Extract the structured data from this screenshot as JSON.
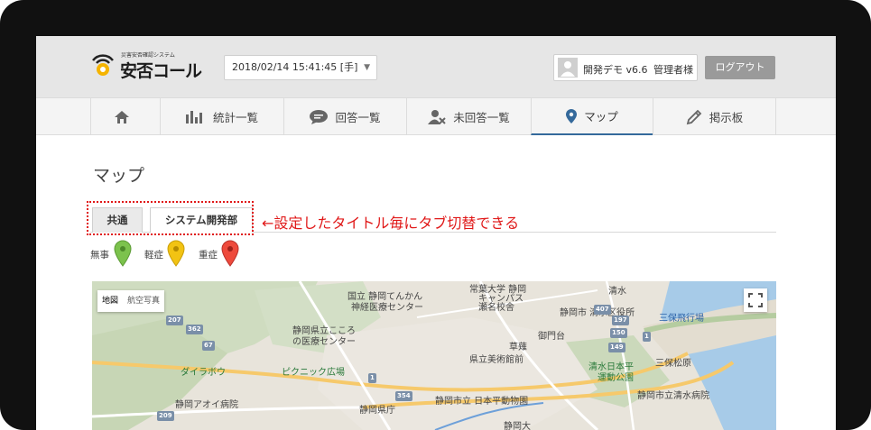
{
  "app": {
    "logo_small": "災害安否確認システム",
    "logo_text": "安否コール"
  },
  "header": {
    "datetime_select": "2018/02/14 15:41:45 [手]",
    "user_name": "開発デモ v6.6",
    "user_role": "管理者様",
    "logout_label": "ログアウト"
  },
  "nav": {
    "items": [
      {
        "label": "",
        "icon": "home-icon"
      },
      {
        "label": "統計一覧",
        "icon": "bar-chart-icon"
      },
      {
        "label": "回答一覧",
        "icon": "chat-icon"
      },
      {
        "label": "未回答一覧",
        "icon": "user-x-icon"
      },
      {
        "label": "マップ",
        "icon": "map-pin-icon",
        "active": true
      },
      {
        "label": "掲示板",
        "icon": "pencil-icon"
      }
    ]
  },
  "page": {
    "title": "マップ",
    "tabs": [
      "共通",
      "システム開発部"
    ],
    "annotation": "←設定したタイトル毎にタブ切替できる"
  },
  "legend": [
    {
      "label": "無事",
      "color": "#7cc24d"
    },
    {
      "label": "軽症",
      "color": "#f2c313"
    },
    {
      "label": "重症",
      "color": "#ee4a3c"
    }
  ],
  "map": {
    "toggle": [
      "地図",
      "航空写真"
    ],
    "labels": {
      "l1": "国立 静岡てんかん",
      "l2": "神経医療センター",
      "l3": "常葉大学 静岡",
      "l4": "キャンパス",
      "l5": "瀬名校舎",
      "l6": "清水",
      "l7": "静岡市 清水区役所",
      "l8": "三保飛行場",
      "l9": "静岡県立こころ",
      "l10": "の医療センター",
      "l11": "ダイラボウ",
      "l12": "ピクニック広場",
      "l13": "清水日本平",
      "l14": "運動公園",
      "l15": "三保松原",
      "l16": "静岡アオイ病院",
      "l17": "静岡県庁",
      "l18": "静岡市立 日本平動物園",
      "l19": "静岡市立清水病院",
      "l20": "静岡大",
      "l21": "草薙",
      "l22": "県立美術館前",
      "l23": "御門台"
    },
    "roads": [
      "207",
      "362",
      "67",
      "1",
      "354",
      "209",
      "149",
      "150",
      "197",
      "407",
      "1"
    ]
  }
}
